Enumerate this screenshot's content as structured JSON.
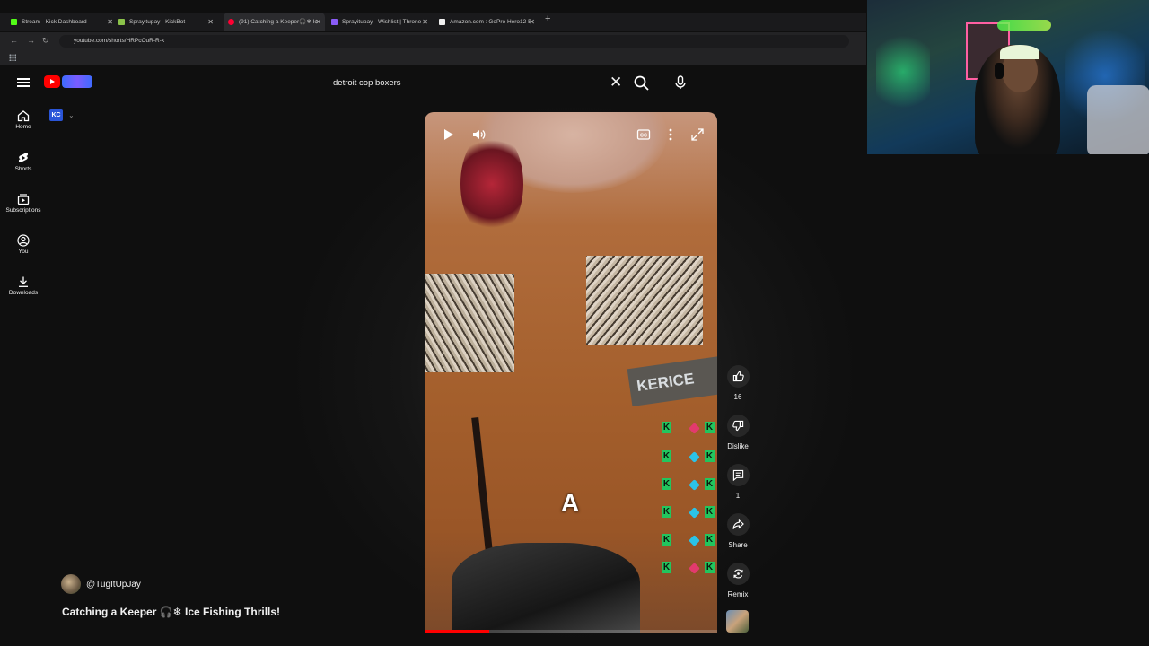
{
  "browser": {
    "tabs": [
      {
        "title": "Stream - Kick Dashboard",
        "fav_color": "#53fc18"
      },
      {
        "title": "Sprayitupay - KickBot",
        "fav_color": "#8bc34a"
      },
      {
        "title": "(91) Catching a Keeper🎧❄ Ic",
        "fav_color": "#ff0033"
      },
      {
        "title": "Sprayitupay - Wishlist | Throne",
        "fav_color": "#8a5cf6"
      },
      {
        "title": "Amazon.com : GoPro Hero12 B",
        "fav_color": "#f0f0f0"
      }
    ],
    "url": "youtube.com/shorts/HRPcOuR-R-k"
  },
  "search": {
    "query": "detroit cop boxers"
  },
  "guide": {
    "items": [
      {
        "label": "Home",
        "icon": "home-icon"
      },
      {
        "label": "Shorts",
        "icon": "shorts-icon"
      },
      {
        "label": "Subscriptions",
        "icon": "subscriptions-icon"
      },
      {
        "label": "You",
        "icon": "you-icon"
      },
      {
        "label": "Downloads",
        "icon": "download-icon"
      }
    ]
  },
  "account": {
    "chip": "KC"
  },
  "player": {
    "patch_text": "KERICE",
    "overlay_letter": "A",
    "progress": 0.22
  },
  "actions": {
    "like_count": "16",
    "dislike_label": "Dislike",
    "comment_count": "1",
    "share_label": "Share",
    "remix_label": "Remix"
  },
  "video": {
    "channel": "@TugItUpJay",
    "title": "Catching a Keeper 🎧❄  Ice Fishing Thrills!"
  },
  "colors": {
    "background": "#0f0f0f",
    "youtube_red": "#ff0000",
    "kick_green": "#22c55e"
  }
}
